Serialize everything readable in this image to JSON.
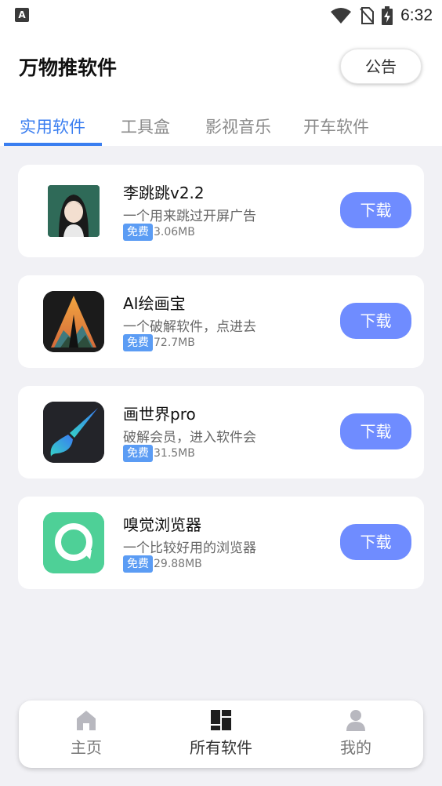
{
  "status_bar": {
    "time": "6:32",
    "left_icon_letter": "A",
    "icons": [
      "wifi-icon",
      "no-sim-icon",
      "battery-charging-icon"
    ]
  },
  "header": {
    "title": "万物推软件",
    "notice_label": "公告"
  },
  "tabs": [
    {
      "label": "实用软件",
      "active": true
    },
    {
      "label": "工具盒",
      "active": false
    },
    {
      "label": "影视音乐",
      "active": false
    },
    {
      "label": "开车软件",
      "active": false
    }
  ],
  "apps": [
    {
      "name": "李跳跳v2.2",
      "desc": "一个用来跳过开屏广告",
      "badge": "免费",
      "size": "3.06MB",
      "button": "下载",
      "icon": "girl-avatar-icon"
    },
    {
      "name": "AI绘画宝",
      "desc": "一个破解软件，点进去",
      "badge": "免费",
      "size": "72.7MB",
      "button": "下载",
      "icon": "ai-painting-icon"
    },
    {
      "name": "画世界pro",
      "desc": "破解会员，进入软件会",
      "badge": "免费",
      "size": "31.5MB",
      "button": "下载",
      "icon": "paintbrush-icon"
    },
    {
      "name": "嗅觉浏览器",
      "desc": "一个比较好用的浏览器",
      "badge": "免费",
      "size": "29.88MB",
      "button": "下载",
      "icon": "chat-bubble-icon"
    }
  ],
  "bottom_nav": [
    {
      "label": "主页",
      "icon": "home-icon",
      "active": false
    },
    {
      "label": "所有软件",
      "icon": "grid-icon",
      "active": true
    },
    {
      "label": "我的",
      "icon": "user-icon",
      "active": false
    }
  ],
  "colors": {
    "accent": "#3a7ef0",
    "download_button": "#6f8cff",
    "badge": "#5b9cf4",
    "background": "#f1f1f5"
  }
}
